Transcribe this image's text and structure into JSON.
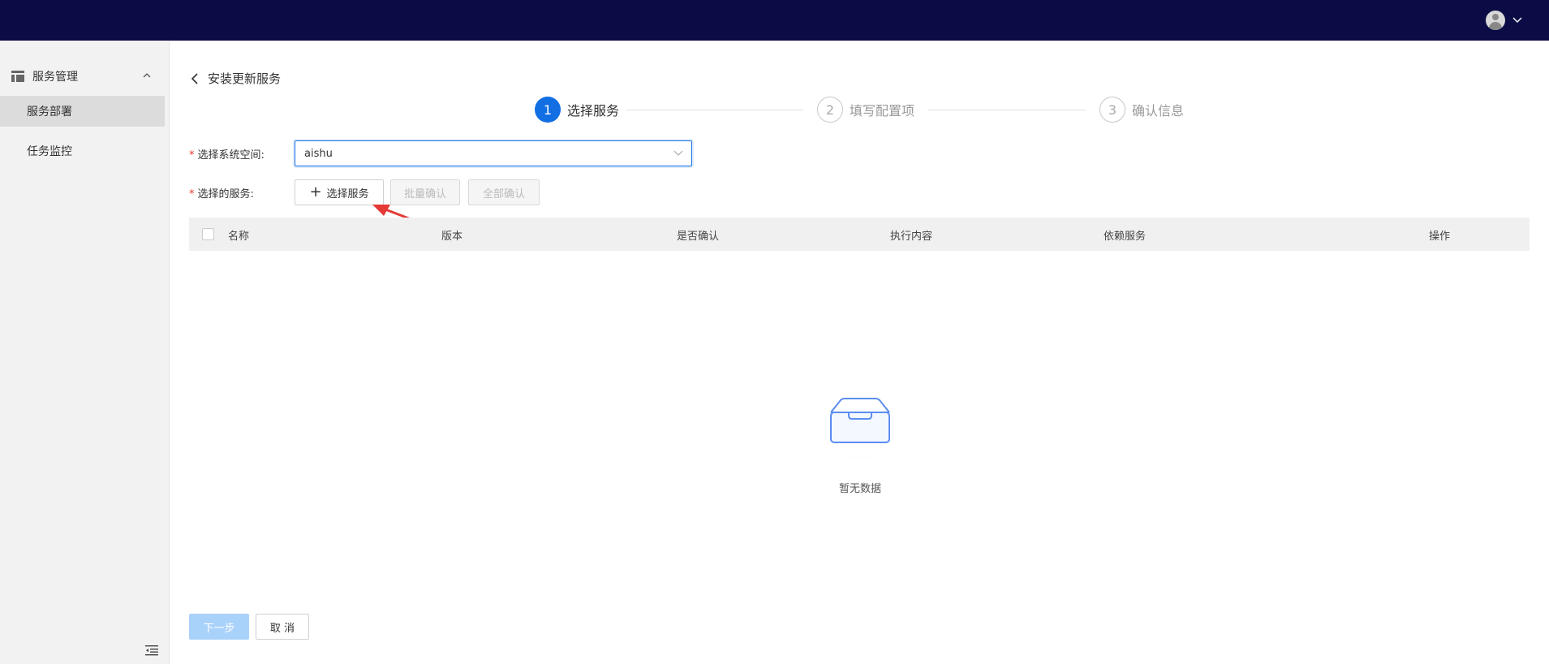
{
  "header": {
    "user_icon": "user-avatar-icon",
    "dropdown_icon": "chevron-down-icon"
  },
  "sidebar": {
    "group": {
      "label": "服务管理",
      "icon": "table-icon",
      "caret_icon": "chevron-up-icon"
    },
    "items": [
      {
        "label": "服务部署",
        "active": true
      },
      {
        "label": "任务监控",
        "active": false
      }
    ],
    "collapse_icon": "collapse-menu-icon"
  },
  "page": {
    "back_icon": "chevron-left-icon",
    "title": "安装更新服务"
  },
  "steps": [
    {
      "num": "1",
      "label": "选择服务",
      "active": true
    },
    {
      "num": "2",
      "label": "填写配置项",
      "active": false
    },
    {
      "num": "3",
      "label": "确认信息",
      "active": false
    }
  ],
  "form": {
    "required_mark": "*",
    "space_label": "选择系统空间:",
    "space_value": "aishu",
    "services_label": "选择的服务:",
    "add_button": "选择服务",
    "batch_confirm": "批量确认",
    "confirm_all": "全部确认"
  },
  "table": {
    "columns": [
      "名称",
      "版本",
      "是否确认",
      "执行内容",
      "依赖服务",
      "操作"
    ]
  },
  "empty": {
    "icon": "empty-inbox-icon",
    "text": "暂无数据"
  },
  "footer": {
    "next": "下一步",
    "cancel": "取 消"
  },
  "colors": {
    "topbar": "#0b0b45",
    "primary": "#126ee3",
    "annotation": "#e53935"
  }
}
